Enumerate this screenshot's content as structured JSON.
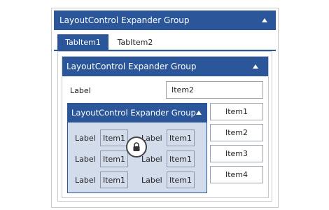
{
  "outer_group": {
    "title": "LayoutControl Expander Group",
    "collapse_icon": "caret-up-icon"
  },
  "tabs": [
    {
      "label": "TabItem1",
      "selected": true
    },
    {
      "label": "TabItem2",
      "selected": false
    }
  ],
  "inner_group": {
    "title": "LayoutControl Expander Group",
    "collapse_icon": "caret-up-icon",
    "label": "Label",
    "field_value": "Item2"
  },
  "nested_group": {
    "title": "LayoutControl Expander Group",
    "collapse_icon": "caret-up-icon",
    "grid": [
      [
        {
          "label": "Label",
          "value": "Item1"
        },
        {
          "label": "Label",
          "value": "Item1"
        }
      ],
      [
        {
          "label": "Label",
          "value": "Item1"
        },
        {
          "label": "Label",
          "value": "Item1"
        }
      ],
      [
        {
          "label": "Label",
          "value": "Item1"
        },
        {
          "label": "Label",
          "value": "Item1"
        }
      ]
    ],
    "lock_icon": "lock-icon"
  },
  "side_items": [
    "Item1",
    "Item2",
    "Item3",
    "Item4"
  ],
  "colors": {
    "header": "#2b579a",
    "nested_bg": "#d3dceb",
    "border": "#9aa3ad"
  }
}
